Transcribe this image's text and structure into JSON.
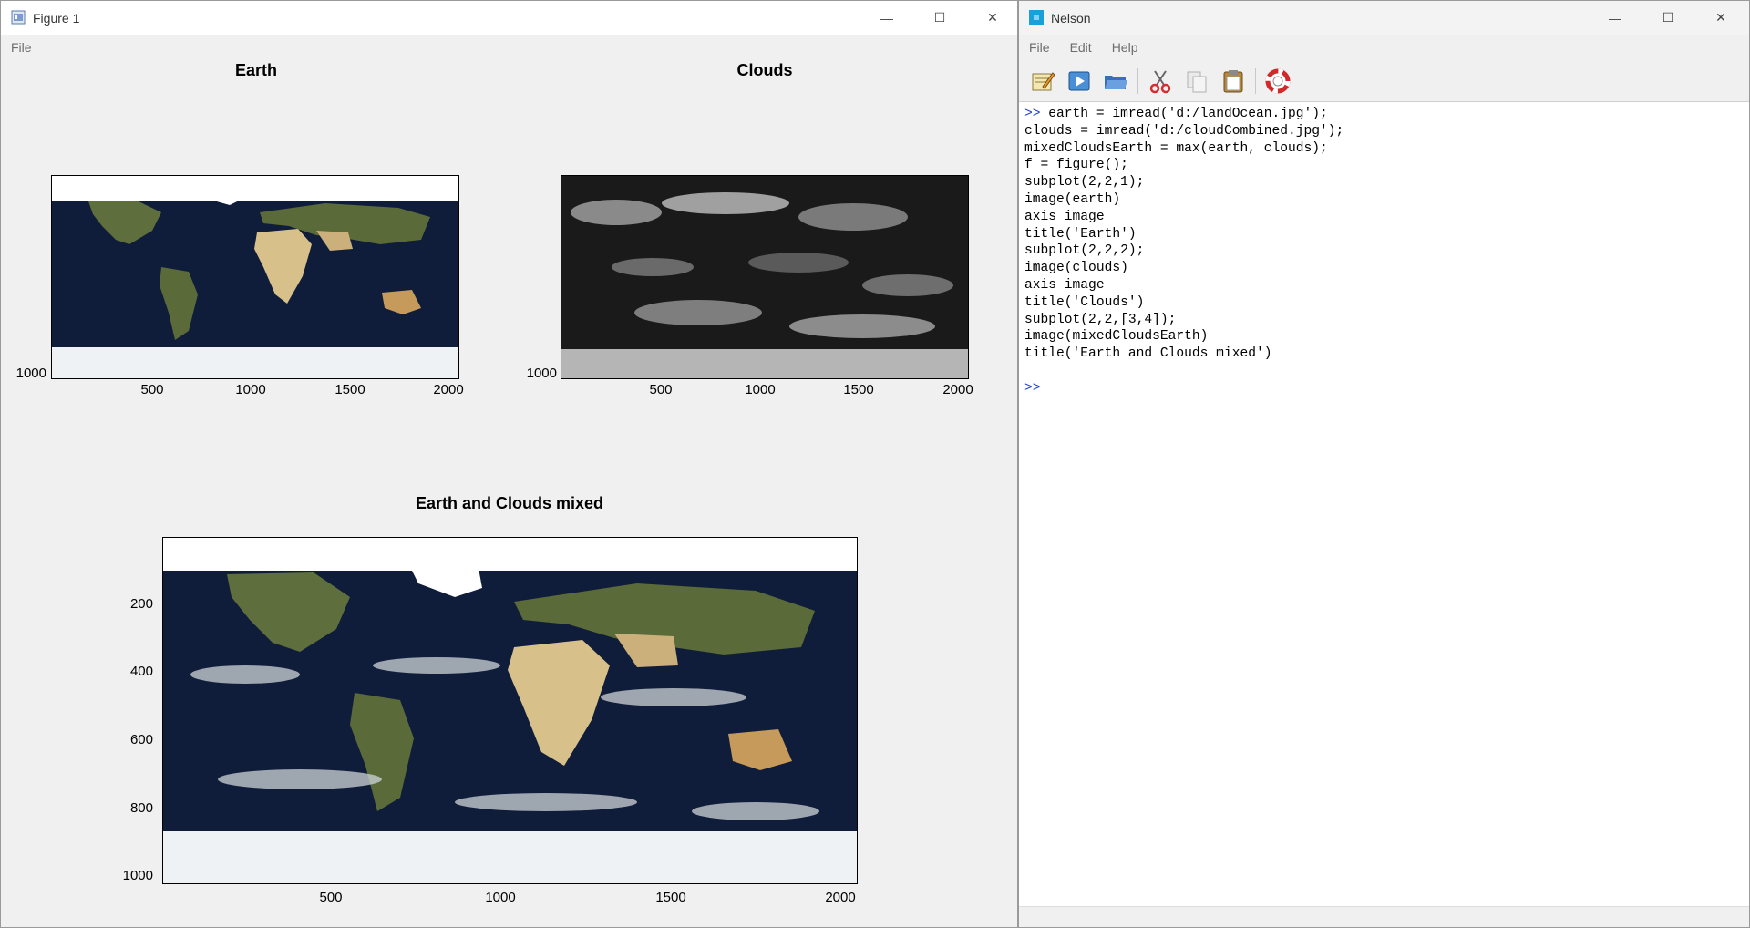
{
  "figure_window": {
    "title": "Figure 1",
    "menu": [
      "File"
    ],
    "controls": {
      "minimize": "—",
      "maximize": "☐",
      "close": "✕"
    },
    "subplots": [
      {
        "title": "Earth",
        "image": "earth",
        "xticks": [
          "500",
          "1000",
          "1500",
          "2000"
        ],
        "yticks": [
          "1000"
        ]
      },
      {
        "title": "Clouds",
        "image": "clouds",
        "xticks": [
          "500",
          "1000",
          "1500",
          "2000"
        ],
        "yticks": [
          "1000"
        ]
      },
      {
        "title": "Earth and Clouds mixed",
        "image": "mixed",
        "xticks": [
          "500",
          "1000",
          "1500",
          "2000"
        ],
        "yticks": [
          "200",
          "400",
          "600",
          "800",
          "1000"
        ]
      }
    ]
  },
  "nelson_window": {
    "title": "Nelson",
    "menu": [
      "File",
      "Edit",
      "Help"
    ],
    "controls": {
      "minimize": "—",
      "maximize": "☐",
      "close": "✕"
    },
    "toolbar_icons": [
      "editor-icon",
      "run-icon",
      "open-folder-icon",
      "cut-icon",
      "copy-icon",
      "paste-icon",
      "help-lifebuoy-icon"
    ],
    "console": {
      "prompt": ">>",
      "lines": [
        "earth = imread('d:/landOcean.jpg');",
        "clouds = imread('d:/cloudCombined.jpg');",
        "mixedCloudsEarth = max(earth, clouds);",
        "f = figure();",
        "subplot(2,2,1);",
        "image(earth)",
        "axis image",
        "title('Earth')",
        "subplot(2,2,2);",
        "image(clouds)",
        "axis image",
        "title('Clouds')",
        "subplot(2,2,[3,4]);",
        "image(mixedCloudsEarth)",
        "title('Earth and Clouds mixed')"
      ]
    }
  },
  "colors": {
    "prompt": "#1d3fd6",
    "ocean": "#0f1d3a",
    "land": "#5a6a38",
    "desert": "#d8c08a",
    "ice": "#eef2f4"
  }
}
